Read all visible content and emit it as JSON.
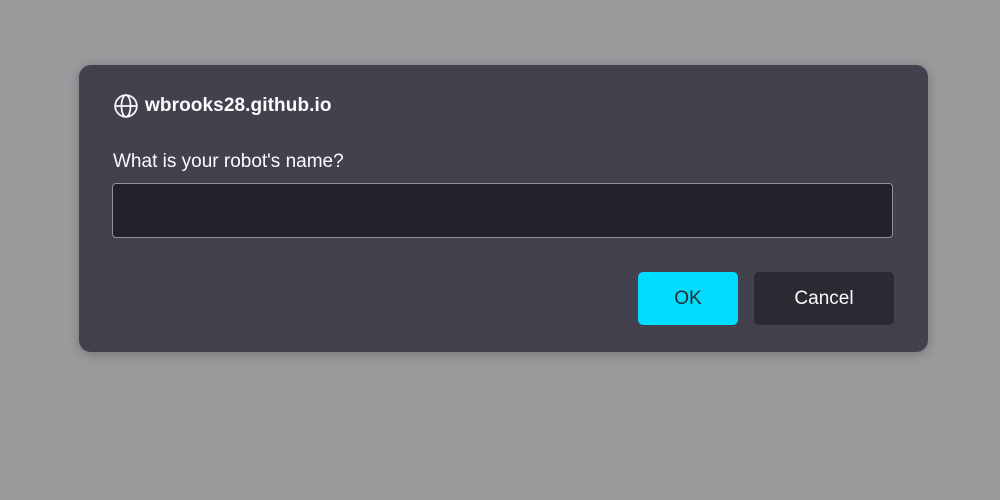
{
  "dialog": {
    "origin": "wbrooks28.github.io",
    "origin_icon": "globe-icon",
    "prompt": "What is your robot's name?",
    "input_value": "",
    "ok_label": "OK",
    "cancel_label": "Cancel"
  },
  "colors": {
    "backdrop": "#9a999c",
    "dialog_bg": "#42414d",
    "input_bg": "#23222b",
    "ok_bg": "#00ddff",
    "cancel_bg": "#2b2a33"
  }
}
